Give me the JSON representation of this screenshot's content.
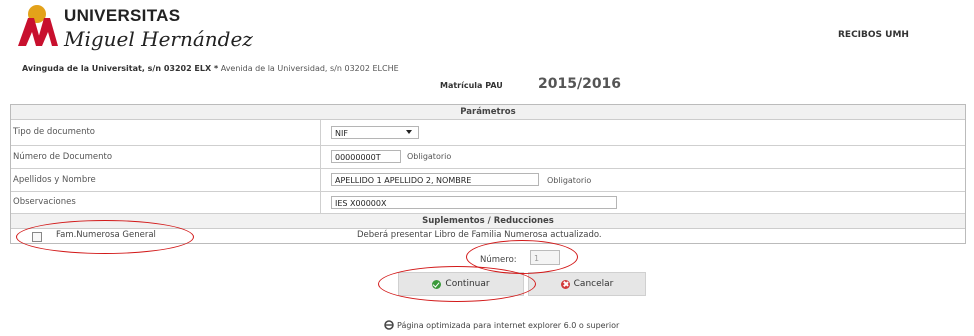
{
  "header": {
    "logo_top": "UNIVERSITAS",
    "logo_name": "Miguel Hernández",
    "app_title": "RECIBOS UMH",
    "address_bold": "Avinguda de la Universitat, s/n 03202 ELX *",
    "address_rest": "Avenida de la Universidad, s/n 03202 ELCHE",
    "matricula_label": "Matrícula PAU",
    "year": "2015/2016"
  },
  "form": {
    "section_params": "Parámetros",
    "tipo_label": "Tipo de documento",
    "tipo_value": "NIF",
    "numdoc_label": "Número de Documento",
    "numdoc_value": "00000000T",
    "numdoc_hint": "Obligatorio",
    "nombre_label": "Apellidos y Nombre",
    "nombre_value": "APELLIDO 1 APELLIDO 2, NOMBRE",
    "nombre_hint": "Obligatorio",
    "obs_label": "Observaciones",
    "obs_value": "IES X00000X",
    "section_supl": "Suplementos / Reducciones",
    "fam_label": "Fam.Numerosa General",
    "fam_note": "Deberá presentar Libro de Familia Numerosa actualizado.",
    "numero_label": "Número:",
    "numero_value": "1"
  },
  "buttons": {
    "continuar": "Continuar",
    "cancelar": "Cancelar"
  },
  "footer": {
    "text": "Página optimizada para internet explorer 6.0 o superior"
  },
  "colors": {
    "annotation": "#d21919",
    "logo_red": "#c8102e",
    "logo_gold": "#e3a21a"
  }
}
